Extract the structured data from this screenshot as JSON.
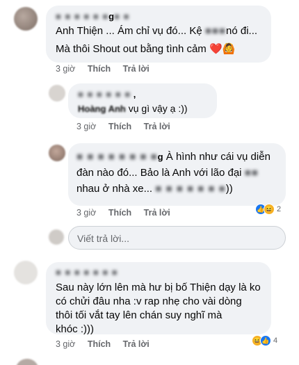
{
  "comment1": {
    "name": "g",
    "lines": [
      "Anh Thiện ... Ám chỉ vụ đó... Kệ",
      "nó đi...",
      "Mà thôi Shout out bằng tình cảm"
    ],
    "emoji": [
      "❤️",
      "🙆"
    ],
    "time": "3 giờ",
    "like": "Thích",
    "reply": "Trả lời"
  },
  "reply1": {
    "name_tail": "vụ gì vậy ạ :))",
    "name_visible": "Hoàng Anh",
    "time": "3 giờ",
    "like": "Thích",
    "reply": "Trả lời"
  },
  "reply2": {
    "name_frag": "g",
    "lines": [
      "À hình như cái vụ diễn",
      "đàn nào đó... Bảo là Anh với lão đại",
      "nhau ở nhà xe...",
      "))"
    ],
    "time": "3 giờ",
    "like": "Thích",
    "reply": "Trả lời",
    "reaction_count": "2"
  },
  "reply_input": {
    "placeholder": "Viết trả lời..."
  },
  "comment2": {
    "lines": [
      "Sau này lớn lên mà hư bị bố Thiện dạy là ko",
      "có chửi đâu nha :v rap nhẹ cho vài dòng",
      "thôi tối vắt tay lên chán suy nghĩ mà",
      "khóc :)))"
    ],
    "time": "3 giờ",
    "like": "Thích",
    "reply": "Trả lời",
    "reaction_count": "4"
  },
  "colors": {
    "bubble": "#f0f2f5",
    "meta": "#65676b",
    "like_blue": "#1877f2",
    "haha_yellow": "#f7b125"
  }
}
